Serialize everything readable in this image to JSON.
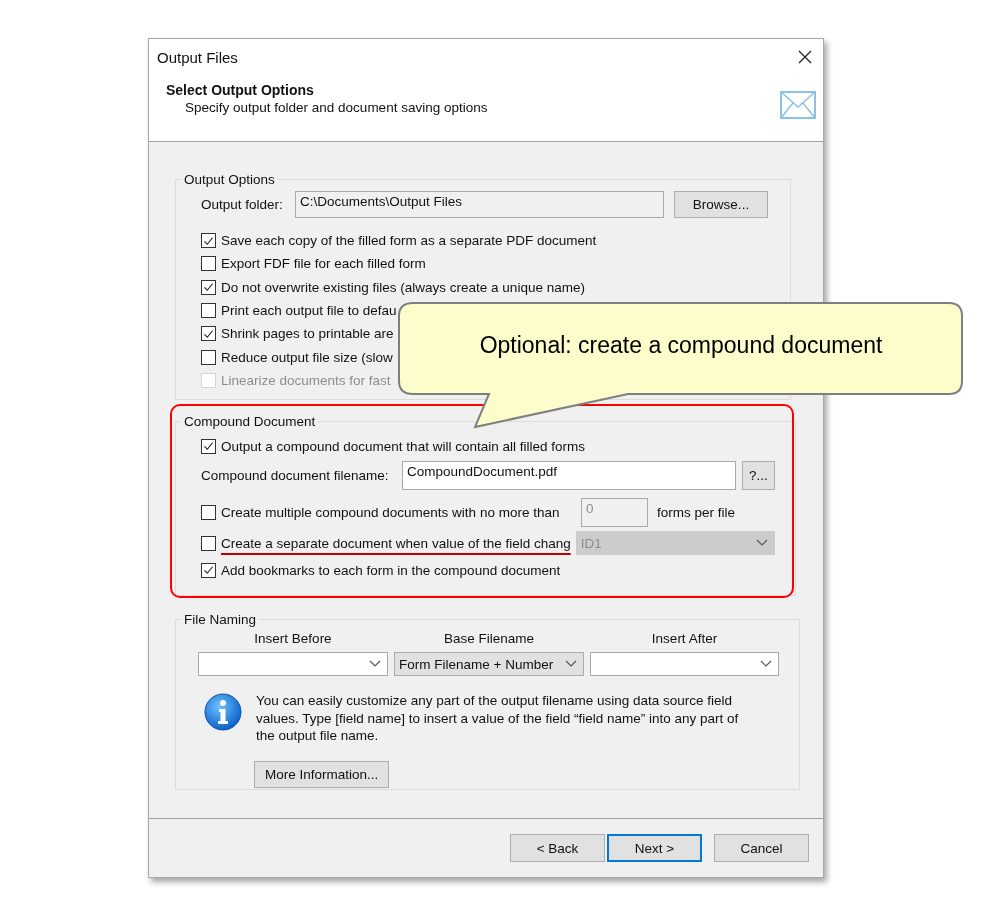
{
  "window": {
    "title": "Output Files"
  },
  "header": {
    "title": "Select Output Options",
    "subtitle": "Specify output folder and document saving options"
  },
  "output_options": {
    "title": "Output Options",
    "folder_label": "Output folder:",
    "folder_value": "C:\\Documents\\Output Files",
    "browse_label": "Browse...",
    "checkboxes": [
      {
        "label": "Save each copy of the filled form as a separate PDF document",
        "checked": true,
        "disabled": false
      },
      {
        "label": "Export FDF file for each filled form",
        "checked": false,
        "disabled": false
      },
      {
        "label": "Do not overwrite existing files (always create a unique name)",
        "checked": true,
        "disabled": false
      },
      {
        "label": "Print each output file to defau",
        "checked": false,
        "disabled": false
      },
      {
        "label": "Shrink pages to printable are",
        "checked": true,
        "disabled": false
      },
      {
        "label": "Reduce output file size  (slow",
        "checked": false,
        "disabled": false
      },
      {
        "label": "Linearize documents for fast",
        "checked": false,
        "disabled": true
      }
    ]
  },
  "compound_document": {
    "title": "Compound Document",
    "output_compound": {
      "label": "Output a compound document that will contain all filled forms",
      "checked": true
    },
    "filename": {
      "label": "Compound document filename:",
      "value": "CompoundDocument.pdf",
      "button_label": "?..."
    },
    "multiple": {
      "label": "Create multiple compound documents with no more than",
      "checked": false,
      "value": "0",
      "value_disabled": true,
      "suffix": "forms per file"
    },
    "separate": {
      "label": "Create a separate document when value of the field chang",
      "checked": false,
      "dropdown_value": "ID1"
    },
    "bookmarks": {
      "label": "Add bookmarks to each form in the compound document",
      "checked": true
    }
  },
  "file_naming": {
    "title": "File Naming",
    "columns": [
      {
        "label": "Insert Before",
        "shaded": false
      },
      {
        "label": "Base Filename",
        "value": "Form Filename + Number",
        "shaded": true
      },
      {
        "label": "Insert After",
        "shaded": false
      }
    ],
    "info": "You can easily customize any part of the output filename using data source field values. Type [field name] to insert a value of the field “field name” into any part of the output file name.",
    "more_label": "More Information..."
  },
  "buttons": [
    {
      "label": "< Back",
      "default": false
    },
    {
      "label": "Next >",
      "default": true
    },
    {
      "label": "Cancel",
      "default": false
    }
  ],
  "callout": {
    "text": "Optional: create a compound document"
  }
}
